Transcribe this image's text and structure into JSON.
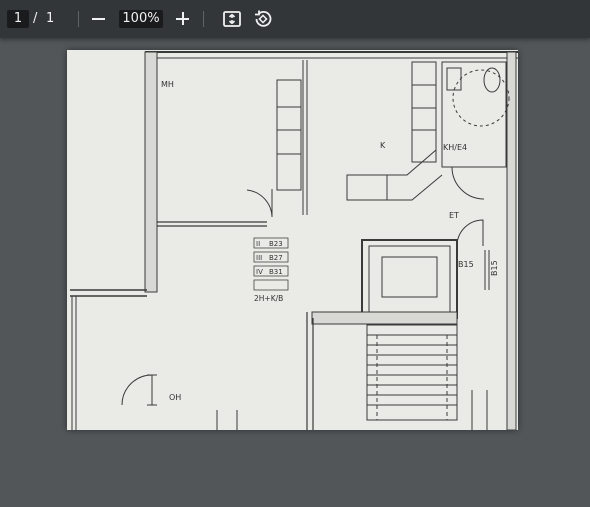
{
  "toolbar": {
    "current_page": "1",
    "page_separator": "/",
    "total_pages": "1",
    "zoom": "100%",
    "icons": [
      "minus-icon",
      "plus-icon",
      "fit-to-page-icon",
      "rotate-icon"
    ]
  },
  "floorplan": {
    "labels": {
      "mh": "MH",
      "k": "K",
      "kh_e4": "KH/E4",
      "et": "ET",
      "oh": "OH",
      "b15_a": "B15",
      "b15_b": "B15"
    },
    "apartments": [
      "B23",
      "B27",
      "B31"
    ],
    "roman": [
      "II",
      "III",
      "IV"
    ],
    "type": "2H+K/B"
  }
}
